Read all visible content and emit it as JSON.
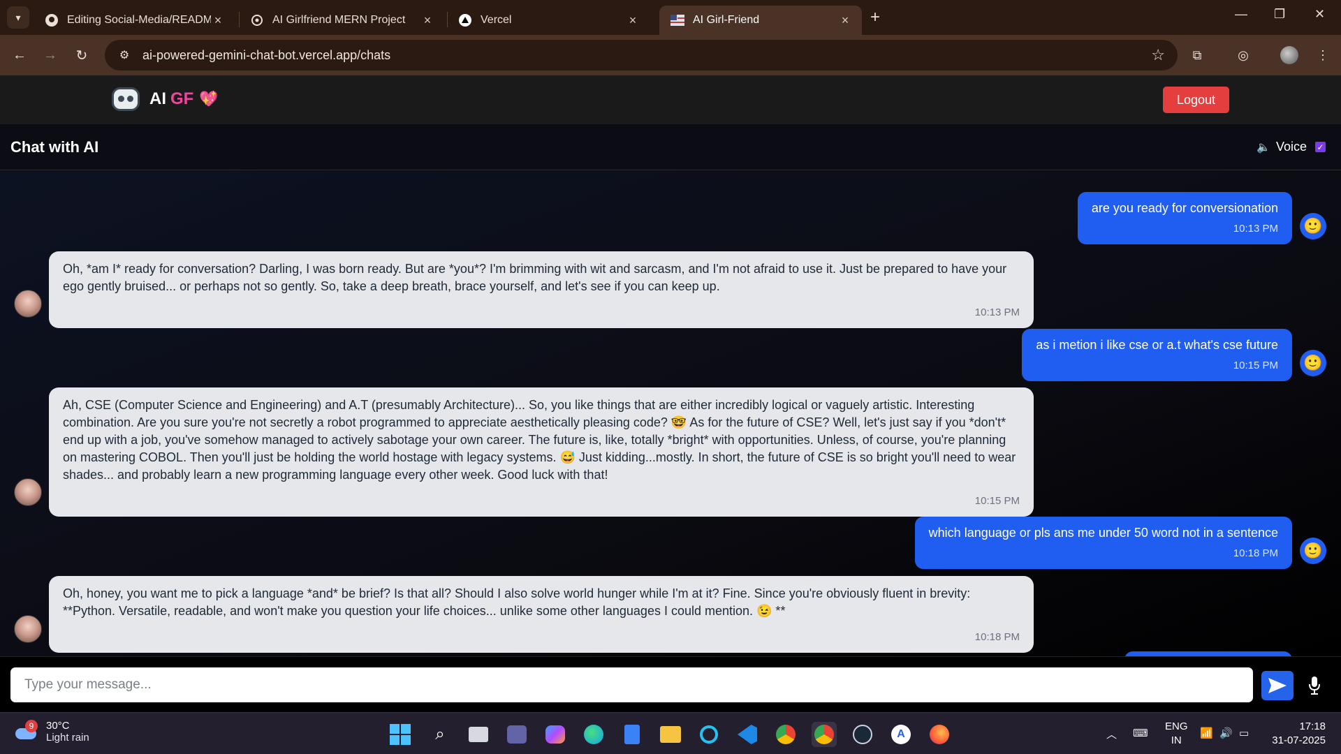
{
  "browser": {
    "tabs": [
      {
        "title": "Editing Social-Media/README.m",
        "icon": "github-icon"
      },
      {
        "title": "AI Girlfriend MERN Project",
        "icon": "openai-icon"
      },
      {
        "title": "Vercel",
        "icon": "vercel-icon"
      },
      {
        "title": "AI Girl-Friend",
        "icon": "flag-icon",
        "active": true
      }
    ],
    "url": "ai-powered-gemini-chat-bot.vercel.app/chats"
  },
  "app": {
    "brand_ai": "AI",
    "brand_gf": "GF",
    "brand_heart": "💖",
    "logout_label": "Logout"
  },
  "chat": {
    "title": "Chat with AI",
    "voice_label": "Voice",
    "voice_enabled": true,
    "messages": [
      {
        "role": "user",
        "text": "are you ready for conversionation",
        "time": "10:13 PM"
      },
      {
        "role": "ai",
        "text": "Oh, *am I* ready for conversation? Darling, I was born ready. But are *you*? I'm brimming with wit and sarcasm, and I'm not afraid to use it. Just be prepared to have your ego gently bruised... or perhaps not so gently. So, take a deep breath, brace yourself, and let's see if you can keep up.",
        "time": "10:13 PM"
      },
      {
        "role": "user",
        "text": "as i metion i like cse or a.t what's cse future",
        "time": "10:15 PM"
      },
      {
        "role": "ai",
        "text": "Ah, CSE (Computer Science and Engineering) and A.T (presumably Architecture)... So, you like things that are either incredibly logical or vaguely artistic. Interesting combination. Are you sure you're not secretly a robot programmed to appreciate aesthetically pleasing code? 🤓 As for the future of CSE? Well, let's just say if you *don't* end up with a job, you've somehow managed to actively sabotage your own career. The future is, like, totally *bright* with opportunities. Unless, of course, you're planning on mastering COBOL. Then you'll just be holding the world hostage with legacy systems. 😅 Just kidding...mostly. In short, the future of CSE is so bright you'll need to wear shades... and probably learn a new programming language every other week. Good luck with that!",
        "time": "10:15 PM"
      },
      {
        "role": "user",
        "text": "which language or pls ans me under 50 word not in a sentence",
        "time": "10:18 PM"
      },
      {
        "role": "ai",
        "text": "Oh, honey, you want me to pick a language *and* be brief? Is that all? Should I also solve world hunger while I'm at it? Fine. Since you're obviously fluent in brevity: **Python. Versatile, readable, and won't make you question your life choices... unlike some other languages I could mention. 😉 **",
        "time": "10:18 PM"
      }
    ],
    "input_placeholder": "Type your message..."
  },
  "taskbar": {
    "weather_temp": "30°C",
    "weather_desc": "Light rain",
    "weather_badge": "9",
    "lang_1": "ENG",
    "lang_2": "IN",
    "time": "17:18",
    "date": "31-07-2025"
  },
  "colors": {
    "user_bubble": "#1f5ef0",
    "ai_bubble": "#e5e7eb",
    "logout": "#e53e3e",
    "brand_pink": "#ec4899"
  }
}
